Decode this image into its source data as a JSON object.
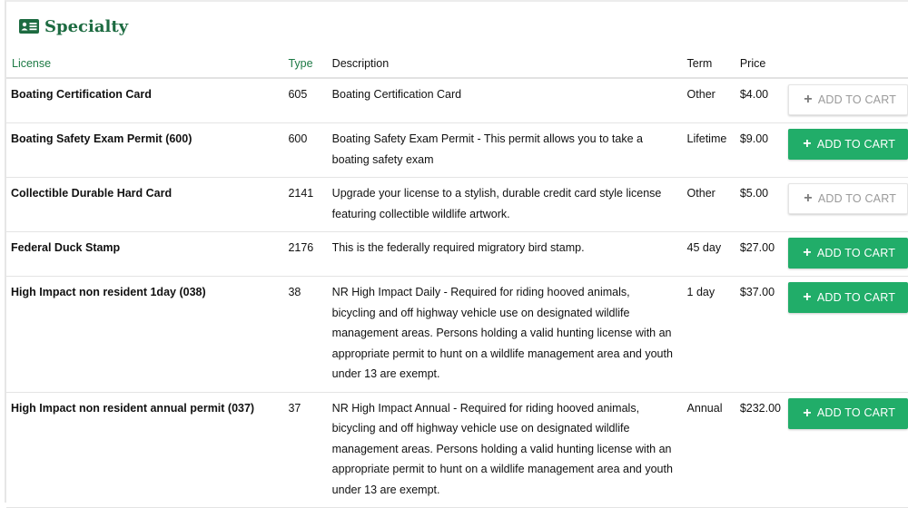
{
  "section": {
    "title": "Specialty",
    "icon": "id-card-icon",
    "accent_color": "#1d6b41",
    "button_color": "#21ad69"
  },
  "table": {
    "headers": {
      "license": "License",
      "type": "Type",
      "description": "Description",
      "term": "Term",
      "price": "Price"
    },
    "rows": [
      {
        "license": "Boating Certification Card",
        "type": "605",
        "description": "Boating Certification Card",
        "term": "Other",
        "price": "$4.00",
        "button_label": "ADD TO CART",
        "button_state": "disabled"
      },
      {
        "license": "Boating Safety Exam Permit (600)",
        "type": "600",
        "description": "Boating Safety Exam Permit - This permit allows you to take a boating safety exam",
        "term": "Lifetime",
        "price": "$9.00",
        "button_label": "ADD TO CART",
        "button_state": "active"
      },
      {
        "license": "Collectible Durable Hard Card",
        "type": "2141",
        "description": "Upgrade your license to a stylish, durable credit card style license featuring collectible wildlife artwork.",
        "term": "Other",
        "price": "$5.00",
        "button_label": "ADD TO CART",
        "button_state": "disabled"
      },
      {
        "license": "Federal Duck Stamp",
        "type": "2176",
        "description": "This is the federally required migratory bird stamp.",
        "term": "45 day",
        "price": "$27.00",
        "button_label": "ADD TO CART",
        "button_state": "active"
      },
      {
        "license": "High Impact non resident 1day (038)",
        "type": "38",
        "description": "NR High Impact Daily - Required for riding hooved animals, bicycling and off highway vehicle use on designated wildlife management areas. Persons holding a valid hunting license with an appropriate permit to hunt on a wildlife management area and youth under 13 are exempt.",
        "term": "1 day",
        "price": "$37.00",
        "button_label": "ADD TO CART",
        "button_state": "active"
      },
      {
        "license": "High Impact non resident annual permit (037)",
        "type": "37",
        "description": "NR High Impact Annual - Required for riding hooved animals, bicycling and off highway vehicle use on designated wildlife management areas. Persons holding a valid hunting license with an appropriate permit to hunt on a wildlife management area and youth under 13 are exempt.",
        "term": "Annual",
        "price": "$232.00",
        "button_label": "ADD TO CART",
        "button_state": "active"
      }
    ]
  }
}
